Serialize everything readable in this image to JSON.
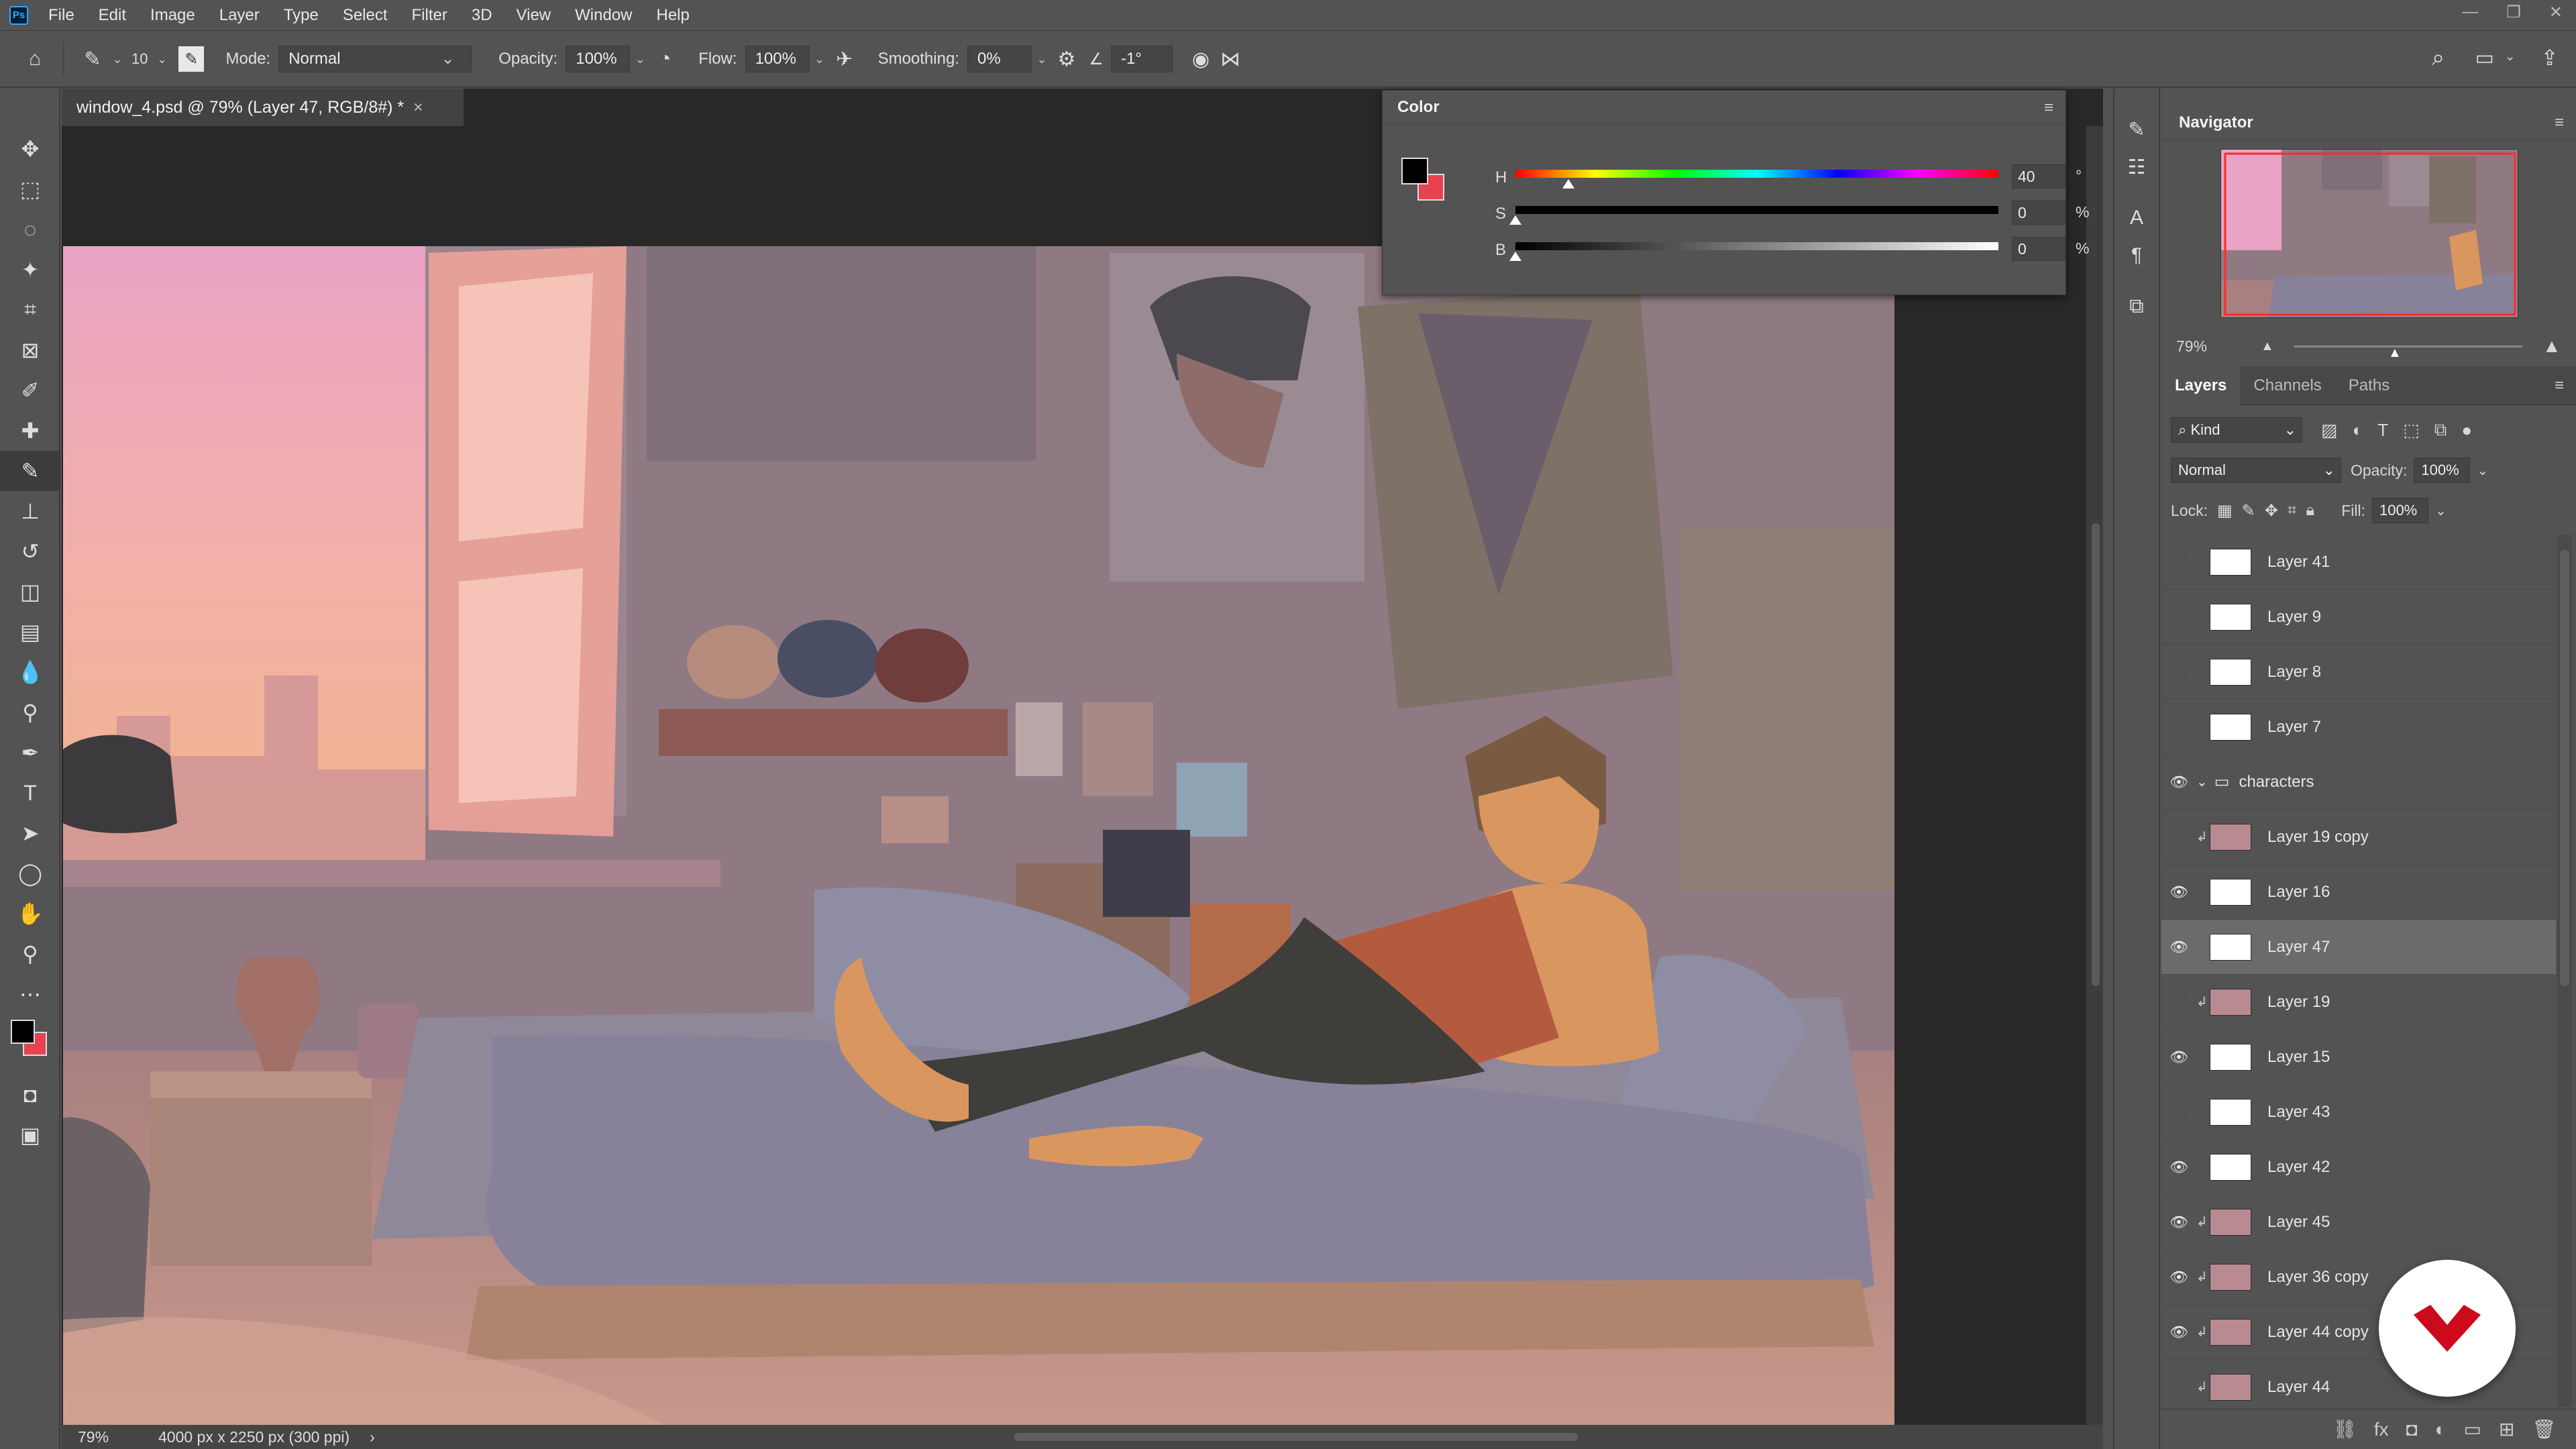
{
  "menubar": {
    "logo": "Ps",
    "items": [
      "File",
      "Edit",
      "Image",
      "Layer",
      "Type",
      "Select",
      "Filter",
      "3D",
      "View",
      "Window",
      "Help"
    ],
    "window_controls": [
      "—",
      "❐",
      "✕"
    ]
  },
  "options": {
    "brush_size": "10",
    "mode_label": "Mode:",
    "mode_value": "Normal",
    "opacity_label": "Opacity:",
    "opacity_value": "100%",
    "flow_label": "Flow:",
    "flow_value": "100%",
    "smoothing_label": "Smoothing:",
    "smoothing_value": "0%",
    "angle_value": "-1°"
  },
  "document": {
    "tab_title": "window_4.psd @ 79% (Layer 47, RGB/8#) *",
    "tab_close": "×",
    "zoom": "79%",
    "doc_size": "4000 px x 2250 px (300 ppi)",
    "status_arrow": "›"
  },
  "color_panel": {
    "title": "Color",
    "menu_icon": "≡",
    "h_label": "H",
    "h_value": "40",
    "h_unit": "°",
    "h_fraction": 0.11,
    "s_label": "S",
    "s_value": "0",
    "s_unit": "%",
    "s_fraction": 0,
    "b_label": "B",
    "b_value": "0",
    "b_unit": "%",
    "b_fraction": 0,
    "foreground": "#000000",
    "background": "#e8424f"
  },
  "navigator": {
    "title": "Navigator",
    "zoom": "79%"
  },
  "layers_panel": {
    "tabs": [
      "Layers",
      "Channels",
      "Paths"
    ],
    "filter_label": "Kind",
    "blend_mode": "Normal",
    "opacity_label": "Opacity:",
    "opacity_value": "100%",
    "lock_label": "Lock:",
    "fill_label": "Fill:",
    "fill_value": "100%",
    "layers": [
      {
        "name": "Layer 41",
        "visible": false,
        "clip": false,
        "group": false
      },
      {
        "name": "Layer 9",
        "visible": false,
        "clip": false,
        "group": false
      },
      {
        "name": "Layer 8",
        "visible": false,
        "clip": false,
        "group": false
      },
      {
        "name": "Layer 7",
        "visible": false,
        "clip": false,
        "group": false
      },
      {
        "name": "characters",
        "visible": true,
        "clip": false,
        "group": true
      },
      {
        "name": "Layer 19 copy",
        "visible": false,
        "clip": true,
        "group": false
      },
      {
        "name": "Layer 16",
        "visible": true,
        "clip": false,
        "group": false
      },
      {
        "name": "Layer 47",
        "visible": true,
        "clip": false,
        "group": false,
        "selected": true
      },
      {
        "name": "Layer 19",
        "visible": false,
        "clip": true,
        "group": false
      },
      {
        "name": "Layer 15",
        "visible": true,
        "clip": false,
        "group": false
      },
      {
        "name": "Layer 43",
        "visible": false,
        "clip": false,
        "group": false
      },
      {
        "name": "Layer 42",
        "visible": true,
        "clip": false,
        "group": false
      },
      {
        "name": "Layer 45",
        "visible": true,
        "clip": true,
        "group": false
      },
      {
        "name": "Layer 36 copy",
        "visible": true,
        "clip": true,
        "group": false
      },
      {
        "name": "Layer 44 copy",
        "visible": true,
        "clip": true,
        "group": false
      },
      {
        "name": "Layer 44",
        "visible": false,
        "clip": true,
        "group": false
      }
    ]
  },
  "colors": {
    "ui_bg": "#535353",
    "canvas_dark": "#282828",
    "accent_red": "#e8424f",
    "brand_red": "#cc0a1c"
  }
}
